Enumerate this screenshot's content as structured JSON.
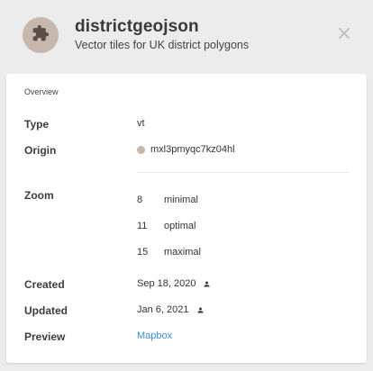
{
  "header": {
    "title": "districtgeojson",
    "subtitle": "Vector tiles for UK district polygons",
    "avatar_icon": "puzzle-icon",
    "close_icon": "close-icon"
  },
  "overview": {
    "section_label": "Overview",
    "type": {
      "label": "Type",
      "value": "vt"
    },
    "origin": {
      "label": "Origin",
      "value": "mxl3pmyqc7kz04hl",
      "dot_color": "#c8b7ad"
    },
    "zoom": {
      "label": "Zoom",
      "levels": [
        {
          "num": "8",
          "name": "minimal"
        },
        {
          "num": "11",
          "name": "optimal"
        },
        {
          "num": "15",
          "name": "maximal"
        }
      ]
    },
    "created": {
      "label": "Created",
      "value": "Sep 18, 2020",
      "icon": "person-icon"
    },
    "updated": {
      "label": "Updated",
      "value": "Jan 6, 2021",
      "icon": "person-icon"
    },
    "preview": {
      "label": "Preview",
      "value": "Mapbox",
      "link_color": "#3a8fd6"
    }
  }
}
